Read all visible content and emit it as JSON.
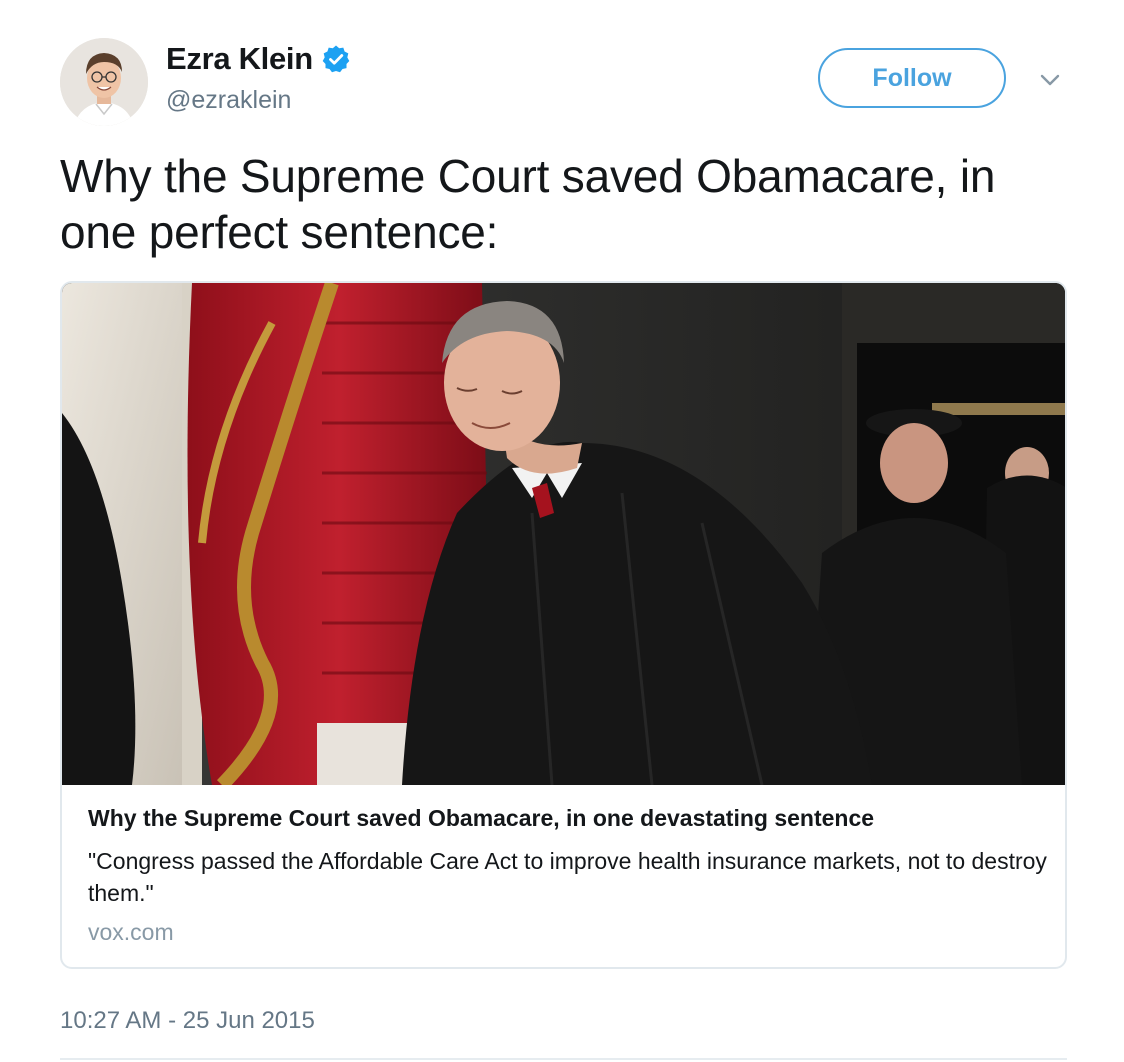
{
  "user": {
    "display_name": "Ezra Klein",
    "handle": "@ezraklein",
    "verified": true,
    "avatar_icon": "avatar-photo"
  },
  "actions": {
    "follow_label": "Follow",
    "menu_icon": "chevron-down-icon"
  },
  "tweet": {
    "text": "Why the Supreme Court saved Obamacare, in one perfect sentence:",
    "timestamp": "10:27 AM - 25 Jun 2015"
  },
  "card": {
    "image_icon": "card-photo",
    "title": "Why the Supreme Court saved Obamacare, in one devastating sentence",
    "description": "\"Congress passed the Affordable Care Act to improve health insurance markets, not to destroy them.\"",
    "domain": "vox.com"
  },
  "colors": {
    "accent": "#4aa3df",
    "verified": "#1da1f2",
    "secondary_text": "#657786",
    "border": "#e1e8ed"
  }
}
